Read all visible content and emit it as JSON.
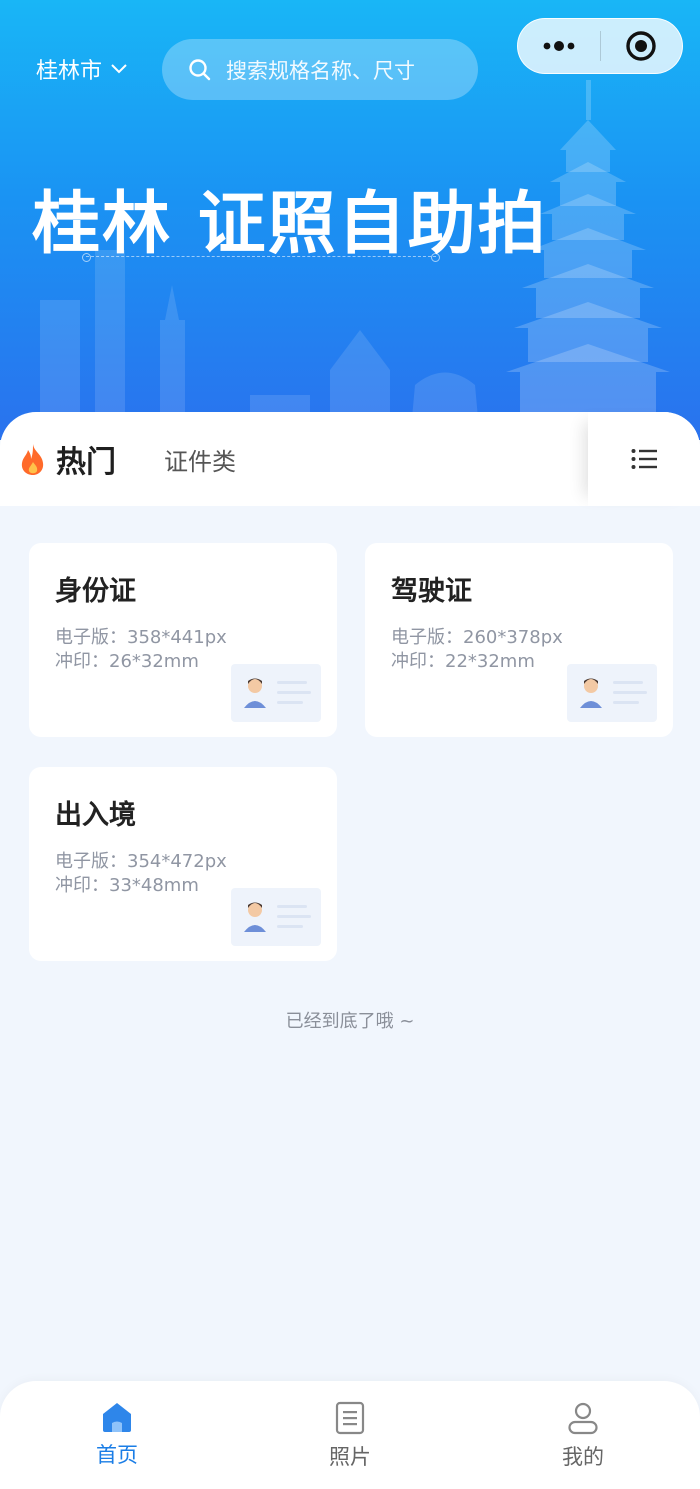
{
  "header": {
    "city": "桂林市",
    "search_placeholder": "搜索规格名称、尺寸",
    "hero_title": "桂林 证照自助拍"
  },
  "tabs": {
    "hot_label": "热门",
    "category_label": "证件类"
  },
  "cards": [
    {
      "title": "身份证",
      "digital": "电子版：358*441px",
      "print": "冲印：26*32mm"
    },
    {
      "title": "驾驶证",
      "digital": "电子版：260*378px",
      "print": "冲印：22*32mm"
    },
    {
      "title": "出入境",
      "digital": "电子版：354*472px",
      "print": "冲印：33*48mm"
    }
  ],
  "footer_note": "已经到底了哦 ~",
  "nav": [
    {
      "label": "首页",
      "icon": "home-icon",
      "active": true
    },
    {
      "label": "照片",
      "icon": "photo-doc-icon",
      "active": false
    },
    {
      "label": "我的",
      "icon": "user-icon",
      "active": false
    }
  ],
  "colors": {
    "accent": "#1a7de6",
    "hero_top": "#19b6f6",
    "hero_bottom": "#2a72ee",
    "page_bg": "#f1f6fd",
    "flame": "#ff6a2a"
  }
}
